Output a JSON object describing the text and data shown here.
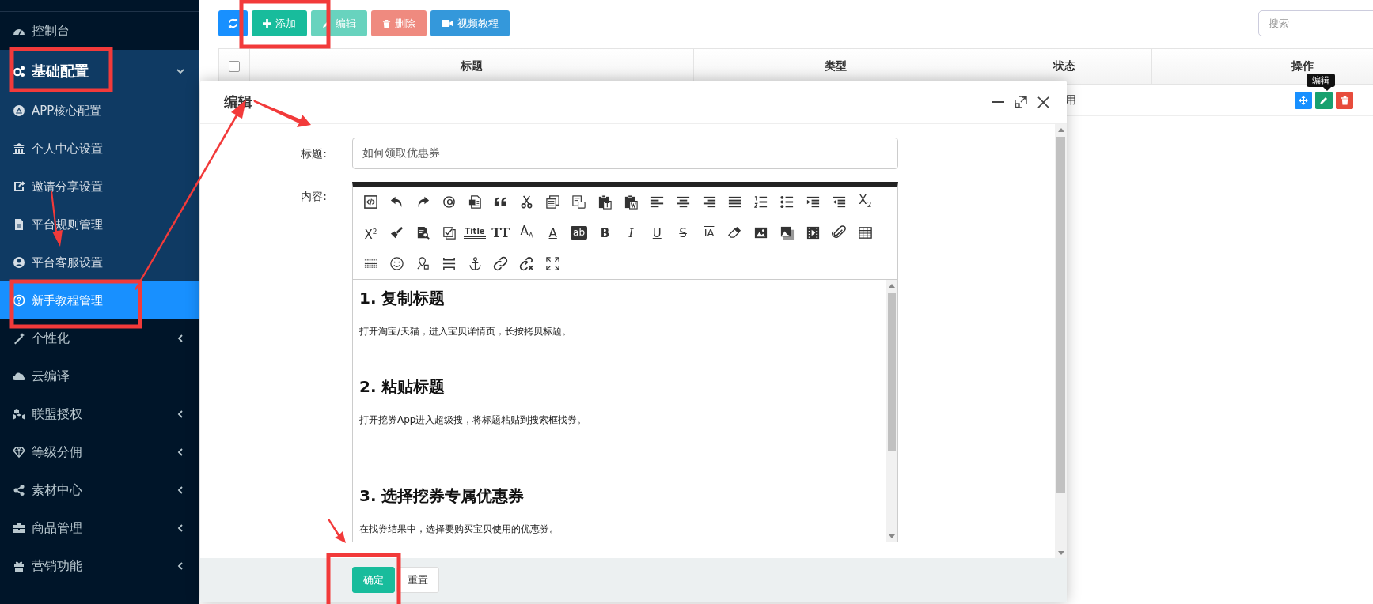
{
  "sidebar": {
    "items": [
      {
        "kind": "link",
        "label": "控制台",
        "selected": false
      },
      {
        "kind": "group",
        "label": "基础配置",
        "expanded": true,
        "children": [
          {
            "label": "APP核心配置",
            "selected": false
          },
          {
            "label": "个人中心设置",
            "selected": false
          },
          {
            "label": "邀请分享设置",
            "selected": false
          },
          {
            "label": "平台规则管理",
            "selected": false
          },
          {
            "label": "平台客服设置",
            "selected": false
          },
          {
            "label": "新手教程管理",
            "selected": true
          }
        ]
      },
      {
        "kind": "group",
        "label": "个性化",
        "expanded": false
      },
      {
        "kind": "link",
        "label": "云编译",
        "selected": false
      },
      {
        "kind": "group",
        "label": "联盟授权",
        "expanded": false
      },
      {
        "kind": "group",
        "label": "等级分佣",
        "expanded": false
      },
      {
        "kind": "group",
        "label": "素材中心",
        "expanded": false
      },
      {
        "kind": "group",
        "label": "商品管理",
        "expanded": false
      },
      {
        "kind": "group",
        "label": "营销功能",
        "expanded": false
      }
    ]
  },
  "toolbar": {
    "buttons": [
      {
        "kind": "refresh",
        "disabled": false
      },
      {
        "kind": "add",
        "label": "添加",
        "disabled": false
      },
      {
        "kind": "edit",
        "label": "编辑",
        "disabled": true
      },
      {
        "kind": "delete",
        "label": "删除",
        "disabled": true
      },
      {
        "kind": "video",
        "label": "视频教程",
        "disabled": false
      }
    ],
    "search": {
      "placeholder": "搜索"
    }
  },
  "table": {
    "select_all": {
      "checked": false
    },
    "columns": [
      "标题",
      "类型",
      "状态",
      "操作"
    ],
    "rows": [
      {
        "status": "用",
        "actions": [
          {
            "kind": "move"
          },
          {
            "kind": "edit"
          },
          {
            "kind": "delete"
          }
        ]
      }
    ]
  },
  "tooltip": {
    "text": "编辑"
  },
  "dialog": {
    "title": "编辑",
    "title_field": {
      "label": "标题:",
      "value": "如何领取优惠券"
    },
    "editor": {
      "label": "内容:",
      "toolbar": [
        [
          {
            "kind": "source"
          },
          {
            "kind": "undo"
          },
          {
            "kind": "redo"
          },
          {
            "kind": "at"
          },
          {
            "kind": "worddoc"
          },
          {
            "kind": "quote"
          },
          {
            "kind": "cut"
          },
          {
            "kind": "copy"
          },
          {
            "kind": "pastebox"
          },
          {
            "kind": "pastetext"
          },
          {
            "kind": "pasteword"
          },
          {
            "kind": "alignleft"
          },
          {
            "kind": "aligncenter"
          },
          {
            "kind": "alignright"
          },
          {
            "kind": "justify"
          },
          {
            "kind": "numlist"
          },
          {
            "kind": "bullist"
          },
          {
            "kind": "indent"
          },
          {
            "kind": "outdent"
          },
          {
            "kind": "script",
            "text": "X$_{2}$"
          }
        ],
        [
          {
            "kind": "script",
            "text": "X$^{2}$"
          },
          {
            "kind": "painter"
          },
          {
            "kind": "docsearch"
          },
          {
            "kind": "checktemplate"
          },
          {
            "kind": "title",
            "text": "Title"
          },
          {
            "kind": "fontfamily",
            "text": "TT"
          },
          {
            "kind": "fontsize",
            "text": "A$_{A}$"
          },
          {
            "kind": "fontcolor",
            "text": "A"
          },
          {
            "kind": "highlight",
            "text": "ab"
          },
          {
            "kind": "bold",
            "text": "B"
          },
          {
            "kind": "italic",
            "text": "I"
          },
          {
            "kind": "underline",
            "text": "U"
          },
          {
            "kind": "strike",
            "text": "S"
          },
          {
            "kind": "clearformat",
            "text": "IA"
          },
          {
            "kind": "eraser"
          },
          {
            "kind": "image"
          },
          {
            "kind": "images"
          },
          {
            "kind": "video"
          },
          {
            "kind": "clip"
          },
          {
            "kind": "table"
          }
        ],
        [
          {
            "kind": "hr"
          },
          {
            "kind": "emoji"
          },
          {
            "kind": "mappin"
          },
          {
            "kind": "pagebreak"
          },
          {
            "kind": "anchor"
          },
          {
            "kind": "link"
          },
          {
            "kind": "unlink"
          },
          {
            "kind": "fullscreen"
          }
        ]
      ],
      "content": [
        {
          "kind": "heading",
          "text": "1. 复制标题"
        },
        {
          "kind": "paragraph",
          "text": "打开淘宝/天猫，进入宝贝详情页，长按拷贝标题。"
        },
        {
          "kind": "blank"
        },
        {
          "kind": "heading",
          "text": "2. 粘贴标题"
        },
        {
          "kind": "paragraph",
          "text": "打开挖券App进入超级搜，将标题粘贴到搜索框找券。"
        },
        {
          "kind": "blank"
        },
        {
          "kind": "blank"
        },
        {
          "kind": "heading",
          "text": "3. 选择挖券专属优惠券"
        },
        {
          "kind": "paragraph",
          "text": "在找券结果中，选择要购买宝贝使用的优惠券。"
        }
      ]
    },
    "buttons": [
      {
        "kind": "primary",
        "label": "确定"
      },
      {
        "kind": "default",
        "label": "重置"
      }
    ]
  }
}
